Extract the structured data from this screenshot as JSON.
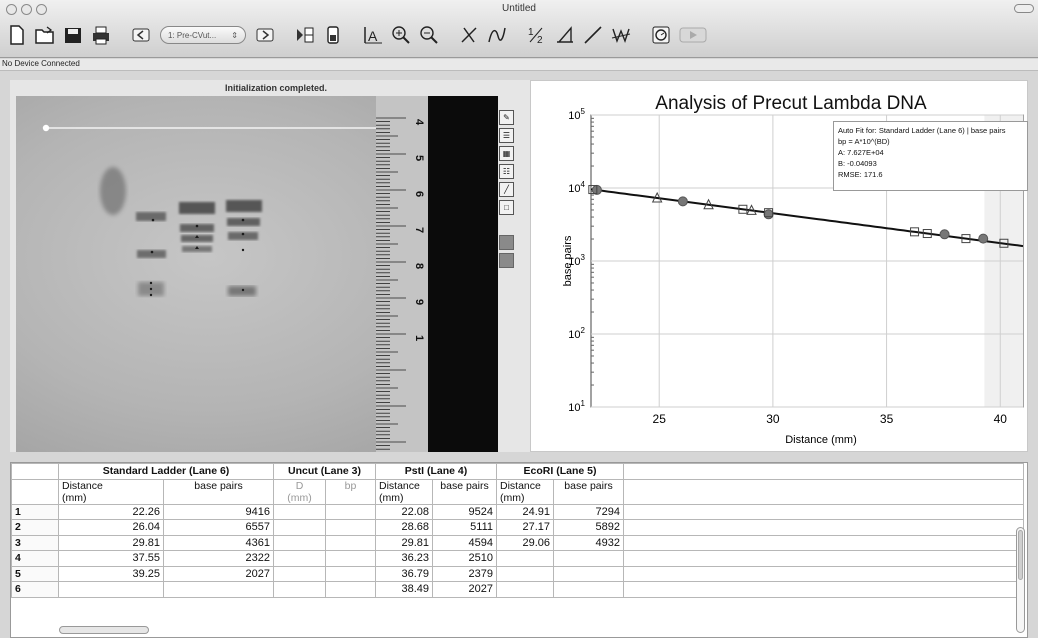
{
  "window": {
    "title": "Untitled"
  },
  "toolbar": {
    "experiment_select": "1: Pre-CVut...",
    "icons": [
      "new-file-icon",
      "open-folder-icon",
      "save-icon",
      "print-icon",
      "back-icon",
      "experiment-select",
      "forward-icon",
      "collect-icon",
      "data-icon",
      "text-annotation-icon",
      "zoom-in-icon",
      "zoom-out-icon",
      "line-tool-icon",
      "curve-tool-icon",
      "half-tool-icon",
      "tangent-icon",
      "linear-fit-icon",
      "curve-fit-icon",
      "stopwatch-icon",
      "play-icon"
    ]
  },
  "status": {
    "device": "No Device Connected"
  },
  "gel": {
    "status_message": "Initialization completed.",
    "ruler_labels": [
      "4",
      "5",
      "6",
      "7",
      "8",
      "9",
      "1"
    ]
  },
  "chart_data": {
    "type": "scatter",
    "title": "Analysis of Precut Lambda DNA",
    "xlabel": "Distance (mm)",
    "ylabel": "base pairs",
    "xlim": [
      22,
      41
    ],
    "ylim_log10": [
      1,
      5
    ],
    "y_scale": "log",
    "x_ticks": [
      "25",
      "30",
      "35",
      "40"
    ],
    "y_ticks": [
      "10^1",
      "10^2",
      "10^3",
      "10^4",
      "10^5"
    ],
    "grid": true,
    "series": [
      {
        "marker": "circle",
        "x": [
          22.26,
          26.04,
          29.81,
          37.55,
          39.25
        ],
        "y": [
          9416,
          6557,
          4361,
          2322,
          2027
        ]
      },
      {
        "marker": "square",
        "x": [
          22.08,
          28.68,
          29.81,
          36.23,
          36.79,
          38.49,
          40.16
        ],
        "y": [
          9524,
          5111,
          4594,
          2510,
          2379,
          2027,
          1750
        ]
      },
      {
        "marker": "triangle",
        "x": [
          24.91,
          27.17,
          29.06
        ],
        "y": [
          7294,
          5892,
          4932
        ]
      }
    ],
    "fit": {
      "A": 76270,
      "B": -0.04093,
      "x_range": [
        22,
        41
      ],
      "lines": [
        "Auto Fit for: Standard Ladder (Lane 6) | base pairs",
        "bp = A*10^(BD)",
        "A: 7.627E+04",
        "B: -0.04093",
        "RMSE: 171.6"
      ]
    }
  },
  "table": {
    "groups": [
      "Standard Ladder (Lane 6)",
      "Uncut (Lane 3)",
      "PstI (Lane 4)",
      "EcoRI (Lane 5)"
    ],
    "subheaders": {
      "ladder": [
        "Distance\n(mm)",
        "base pairs"
      ],
      "uncut": [
        "D\n(mm)",
        "bp"
      ],
      "psti": [
        "Distance\n(mm)",
        "base pairs"
      ],
      "ecori": [
        "Distance\n(mm)",
        "base pairs"
      ]
    },
    "sub_line1": {
      "distance": "Distance",
      "mm": "(mm)",
      "bp_long": "base pairs",
      "d": "D",
      "bp": "bp"
    },
    "rows": [
      {
        "n": "1",
        "ld": "22.26",
        "lb": "9416",
        "ud": "",
        "ub": "",
        "pd": "22.08",
        "pb": "9524",
        "ed": "24.91",
        "eb": "7294"
      },
      {
        "n": "2",
        "ld": "26.04",
        "lb": "6557",
        "ud": "",
        "ub": "",
        "pd": "28.68",
        "pb": "5111",
        "ed": "27.17",
        "eb": "5892"
      },
      {
        "n": "3",
        "ld": "29.81",
        "lb": "4361",
        "ud": "",
        "ub": "",
        "pd": "29.81",
        "pb": "4594",
        "ed": "29.06",
        "eb": "4932"
      },
      {
        "n": "4",
        "ld": "37.55",
        "lb": "2322",
        "ud": "",
        "ub": "",
        "pd": "36.23",
        "pb": "2510",
        "ed": "",
        "eb": ""
      },
      {
        "n": "5",
        "ld": "39.25",
        "lb": "2027",
        "ud": "",
        "ub": "",
        "pd": "36.79",
        "pb": "2379",
        "ed": "",
        "eb": ""
      },
      {
        "n": "6",
        "ld": "",
        "lb": "",
        "ud": "",
        "ub": "",
        "pd": "38.49",
        "pb": "2027",
        "ed": "",
        "eb": ""
      }
    ]
  }
}
